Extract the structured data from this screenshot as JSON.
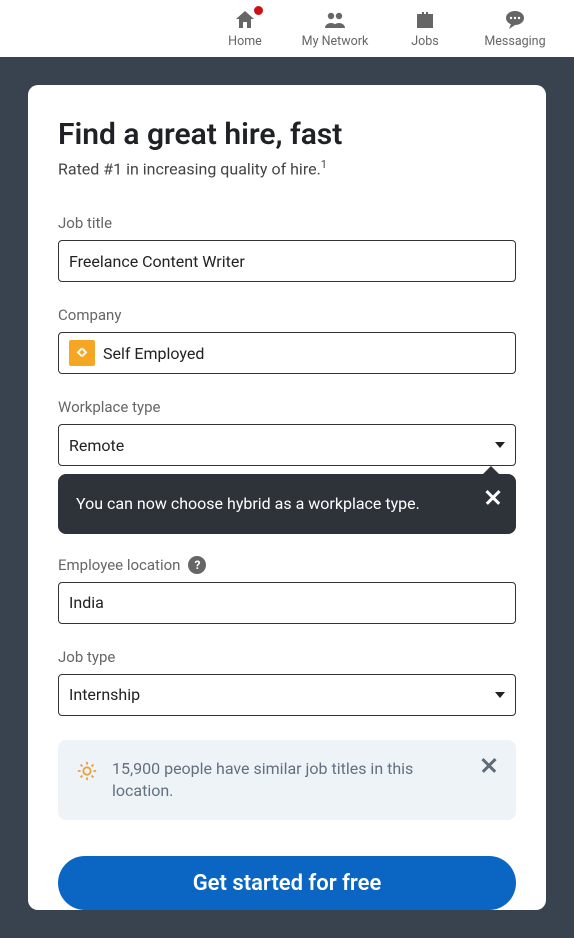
{
  "nav": {
    "home": "Home",
    "network": "My Network",
    "jobs": "Jobs",
    "messaging": "Messaging"
  },
  "heading": "Find a great hire, fast",
  "sub": "Rated #1 in increasing quality of hire.",
  "sup": "1",
  "labels": {
    "title": "Job title",
    "company": "Company",
    "workplace": "Workplace type",
    "location": "Employee location",
    "type": "Job type"
  },
  "values": {
    "title": "Freelance Content Writer",
    "company": "Self Employed",
    "workplace": "Remote",
    "location": "India",
    "type": "Internship"
  },
  "tooltip": "You can now choose hybrid as a workplace type.",
  "info": "15,900 people have similar job titles in this location.",
  "cta": "Get started for free"
}
